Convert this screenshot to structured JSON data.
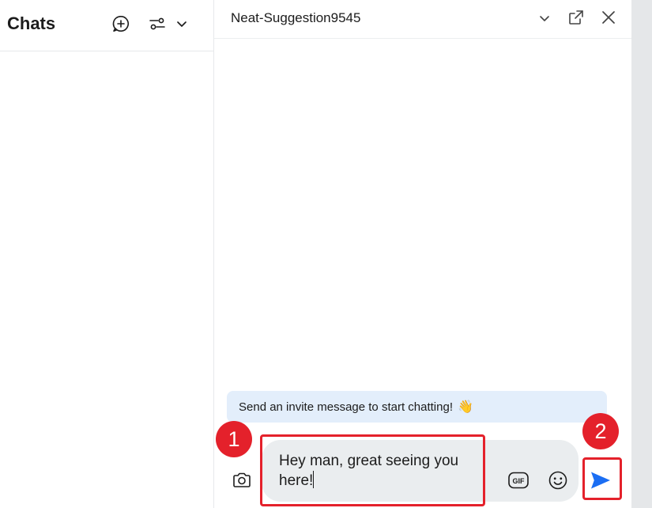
{
  "sidebar": {
    "title": "Chats",
    "new_chat_icon": "new-chat-icon",
    "filter_icon": "filter-sliders-icon",
    "dropdown_icon": "chevron-down-icon"
  },
  "chat": {
    "contact_name": "Neat-Suggestion9545",
    "header_icons": [
      "chevron-down-icon",
      "pop-out-icon",
      "close-icon"
    ],
    "invite_banner": "Send an invite message to start chatting!",
    "invite_emoji": "👋",
    "composer": {
      "text": "Hey man, great seeing you here!",
      "camera_icon": "camera-icon",
      "gif_label": "GIF",
      "emoji_icon": "smiley-icon",
      "send_icon": "send-icon"
    }
  },
  "annotations": {
    "step1": "1",
    "step2": "2",
    "highlight_color": "#e4212b"
  },
  "colors": {
    "accent": "#1b6ef3",
    "banner_bg": "#e3eefb",
    "composer_bg": "#eaedef"
  }
}
